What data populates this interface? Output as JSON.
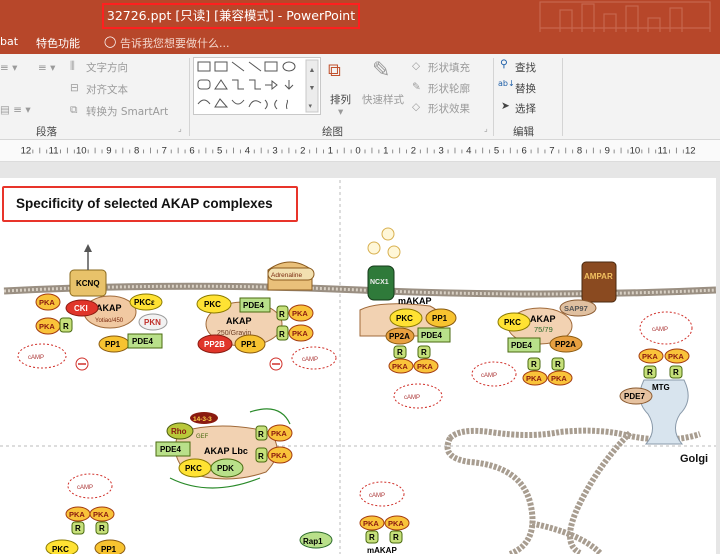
{
  "window": {
    "title": "32726.ppt [只读] [兼容模式] - PowerPoint"
  },
  "menu": {
    "tab_partial": "bat",
    "tab_special": "特色功能",
    "tellme": "告诉我您想要做什么..."
  },
  "ribbon": {
    "text_direction": "文字方向",
    "align_text": "对齐文本",
    "convert_smartart": "转换为 SmartArt",
    "arrange": "排列",
    "quick_styles": "快速样式",
    "shape_fill": "形状填充",
    "shape_outline": "形状轮廓",
    "shape_effects": "形状效果",
    "find": "查找",
    "replace": "替换",
    "select": "选择",
    "group_paragraph": "段落",
    "group_drawing": "绘图",
    "group_editing": "编辑"
  },
  "ruler": {
    "ticks": [
      "12",
      "11",
      "10",
      "9",
      "8",
      "7",
      "6",
      "5",
      "4",
      "3",
      "2",
      "1",
      "0",
      "1",
      "2",
      "3",
      "4",
      "5",
      "6",
      "7",
      "8",
      "9",
      "10",
      "11",
      "12"
    ]
  },
  "slide": {
    "title": "Specificity of selected AKAP complexes",
    "golgi_label": "Golgi",
    "labels": {
      "kcnq": "KCNQ",
      "cki": "CKI",
      "akap_yotiao": "AKAP",
      "yotiao": "Yotiao/450",
      "pkce": "PKCε",
      "pkn": "PKN",
      "pp1": "PP1",
      "pde4": "PDE4",
      "pka": "PKA",
      "r": "R",
      "pkc": "PKC",
      "akap": "AKAP",
      "gravin": "250/Gravin",
      "pp2b": "PP2B",
      "adrenaline": "Adrenaline",
      "ncx1": "NCX1",
      "makap": "mAKAP",
      "pp2a": "PP2A",
      "ampar": "AMPAR",
      "sap97": "SAP97",
      "akap7579": "75/79",
      "mtg": "MTG",
      "pde7": "PDE7",
      "rho": "Rho",
      "gef": "GEF",
      "lbc": "AKAP Lbc",
      "pdk": "PDK",
      "p1433": "14-3-3",
      "rap1": "Rap1",
      "camp": "cAMP"
    }
  }
}
